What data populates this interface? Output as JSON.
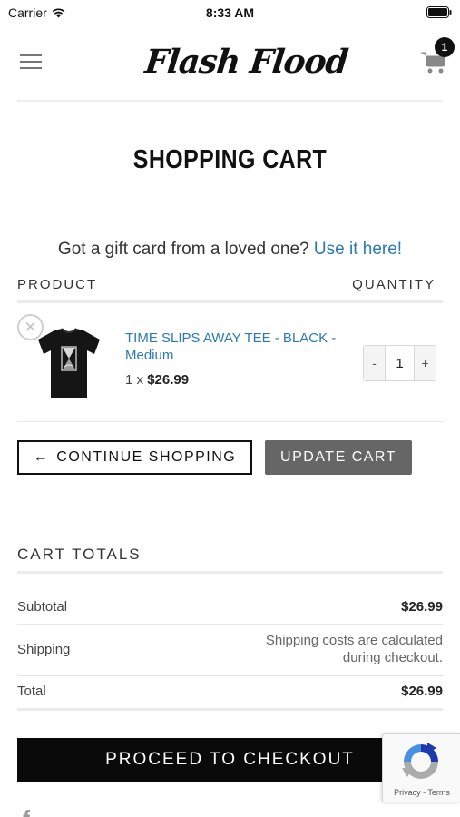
{
  "status_bar": {
    "carrier": "Carrier",
    "time": "8:33 AM"
  },
  "header": {
    "logo_text": "Flash Flood",
    "cart_count": "1",
    "icons": [
      "menu-icon",
      "cart-icon"
    ]
  },
  "page": {
    "title": "SHOPPING CART"
  },
  "gift_card": {
    "text": "Got a gift card from a loved one?",
    "link": "Use it here!"
  },
  "cart_table": {
    "headers": [
      "PRODUCT",
      "QUANTITY"
    ],
    "items": [
      {
        "name": "TIME SLIPS AWAY TEE - BLACK - Medium",
        "qty_prefix": "1 x",
        "price": "$26.99",
        "quantity": "1",
        "decrement": "-",
        "increment": "+"
      }
    ]
  },
  "actions": {
    "continue_arrow": "←",
    "continue_label": "CONTINUE SHOPPING",
    "update_label": "UPDATE CART"
  },
  "totals": {
    "heading": "CART TOTALS",
    "subtotal_label": "Subtotal",
    "subtotal_value": "$26.99",
    "shipping_label": "Shipping",
    "shipping_note": "Shipping costs are calculated during checkout.",
    "total_label": "Total",
    "total_value": "$26.99"
  },
  "checkout": {
    "label": "PROCEED TO CHECKOUT"
  },
  "recaptcha": {
    "links": "Privacy - Terms"
  },
  "colors": {
    "link": "#2a7ab0",
    "button_dark": "#0a0a0a",
    "button_gray": "#666666"
  }
}
